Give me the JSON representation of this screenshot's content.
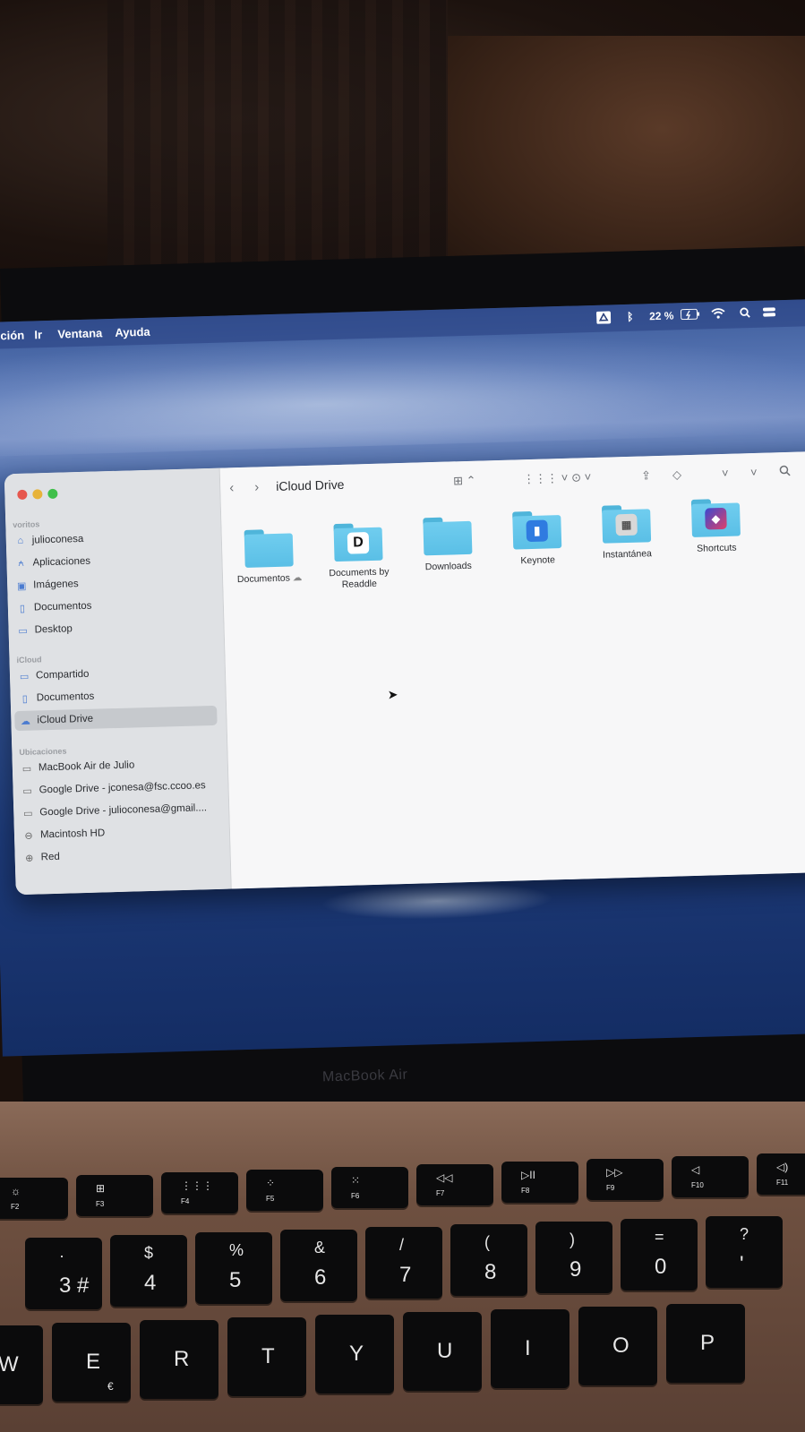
{
  "menubar": {
    "items": [
      "ción",
      "Ir",
      "Ventana",
      "Ayuda"
    ],
    "battery": "22 %"
  },
  "finder": {
    "title": "iCloud Drive",
    "sidebar": {
      "favorites_header": "voritos",
      "favorites": [
        {
          "label": "julioconesa",
          "icon": "home-icon"
        },
        {
          "label": "Aplicaciones",
          "icon": "apps-icon"
        },
        {
          "label": "Imágenes",
          "icon": "photo-icon"
        },
        {
          "label": "Documentos",
          "icon": "document-icon"
        },
        {
          "label": "Desktop",
          "icon": "desktop-icon"
        }
      ],
      "icloud_header": "iCloud",
      "icloud": [
        {
          "label": "Compartido",
          "icon": "shared-folder-icon"
        },
        {
          "label": "Documentos",
          "icon": "document-icon"
        },
        {
          "label": "iCloud Drive",
          "icon": "cloud-icon",
          "selected": true
        }
      ],
      "locations_header": "Ubicaciones",
      "locations": [
        {
          "label": "MacBook Air de Julio",
          "icon": "laptop-icon"
        },
        {
          "label": "Google Drive - jconesa@fsc.ccoo.es",
          "icon": "drive-icon"
        },
        {
          "label": "Google Drive - julioconesa@gmail....",
          "icon": "drive-icon"
        },
        {
          "label": "Macintosh HD",
          "icon": "disk-icon"
        },
        {
          "label": "Red",
          "icon": "network-icon"
        }
      ]
    },
    "files": [
      {
        "name": "Documentos",
        "badge": ""
      },
      {
        "name": "Documents by Readdle",
        "badge": "D"
      },
      {
        "name": "Downloads",
        "badge": ""
      },
      {
        "name": "Keynote",
        "badge": "keynote"
      },
      {
        "name": "Instantánea",
        "badge": "snapshot"
      },
      {
        "name": "Shortcuts",
        "badge": "shortcuts"
      }
    ]
  },
  "laptop": {
    "brand": "MacBook Air"
  },
  "keyboard": {
    "fkeys": [
      {
        "icon": "☼",
        "label": "F2"
      },
      {
        "icon": "⊞",
        "label": "F3"
      },
      {
        "icon": "⋮⋮⋮",
        "label": "F4"
      },
      {
        "icon": "⁘",
        "label": "F5"
      },
      {
        "icon": "⁙",
        "label": "F6"
      },
      {
        "icon": "◁◁",
        "label": "F7"
      },
      {
        "icon": "▷II",
        "label": "F8"
      },
      {
        "icon": "▷▷",
        "label": "F9"
      },
      {
        "icon": "◁",
        "label": "F10"
      },
      {
        "icon": "◁)",
        "label": "F11"
      }
    ],
    "number_row": [
      {
        "top": "·",
        "bot": "3 #"
      },
      {
        "top": "$",
        "bot": "4"
      },
      {
        "top": "%",
        "bot": "5"
      },
      {
        "top": "&",
        "bot": "6"
      },
      {
        "top": "/",
        "bot": "7"
      },
      {
        "top": "(",
        "bot": "8"
      },
      {
        "top": ")",
        "bot": "9"
      },
      {
        "top": "=",
        "bot": "0"
      },
      {
        "top": "?",
        "bot": "'"
      }
    ],
    "letter_row": [
      {
        "main": "W",
        "sub": ""
      },
      {
        "main": "E",
        "sub": "€"
      },
      {
        "main": "R",
        "sub": ""
      },
      {
        "main": "T",
        "sub": ""
      },
      {
        "main": "Y",
        "sub": ""
      },
      {
        "main": "U",
        "sub": ""
      },
      {
        "main": "I",
        "sub": ""
      },
      {
        "main": "O",
        "sub": ""
      },
      {
        "main": "P",
        "sub": ""
      }
    ]
  }
}
